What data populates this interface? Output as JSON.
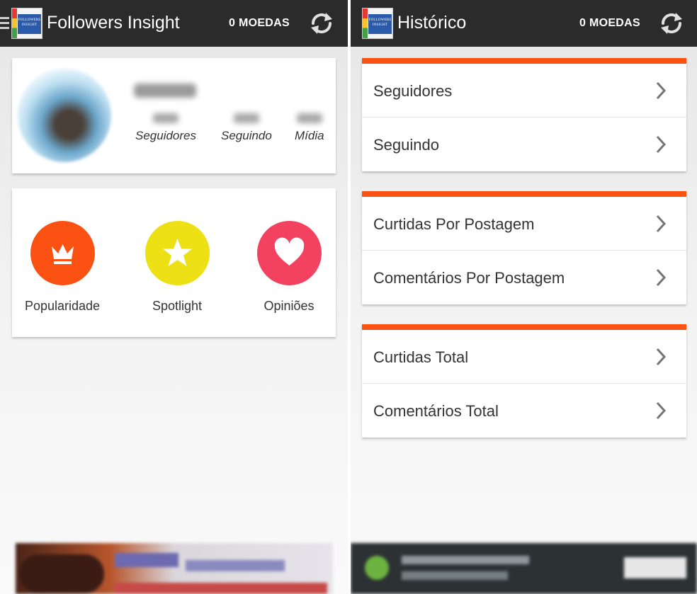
{
  "left": {
    "topbar": {
      "title": "Followers Insight",
      "coins": "0 MOEDAS",
      "logo_text": "FOLLOWERS INSIGHT"
    },
    "profile": {
      "stats": [
        {
          "label": "Seguidores"
        },
        {
          "label": "Seguindo"
        },
        {
          "label": "Mídia"
        }
      ]
    },
    "features": [
      {
        "label": "Popularidade",
        "icon": "crown-icon",
        "color": "#fb5113"
      },
      {
        "label": "Spotlight",
        "icon": "star-icon",
        "color": "#ede116"
      },
      {
        "label": "Opiniões",
        "icon": "heart-icon",
        "color": "#f3425f"
      }
    ]
  },
  "right": {
    "topbar": {
      "title": "Histórico",
      "coins": "0 MOEDAS",
      "logo_text": "FOLLOWERS INSIGHT"
    },
    "groups": [
      {
        "items": [
          {
            "label": "Seguidores"
          },
          {
            "label": "Seguindo"
          }
        ]
      },
      {
        "items": [
          {
            "label": "Curtidas Por Postagem"
          },
          {
            "label": "Comentários Por Postagem"
          }
        ]
      },
      {
        "items": [
          {
            "label": "Curtidas Total"
          },
          {
            "label": "Comentários Total"
          }
        ]
      }
    ]
  },
  "colors": {
    "topbar": "#2b2b2b",
    "accent": "#fb5113"
  }
}
